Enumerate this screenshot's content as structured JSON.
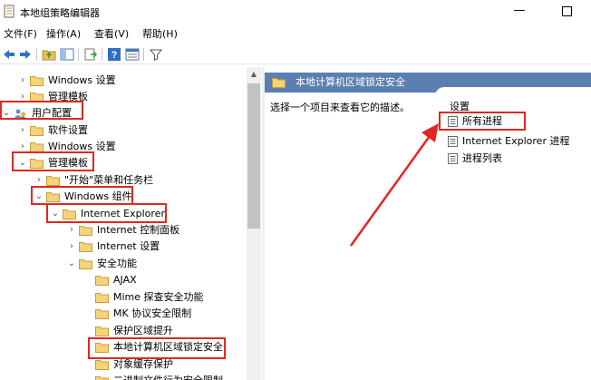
{
  "window": {
    "title": "本地组策略编辑器",
    "minimize_glyph": "—"
  },
  "menu": [
    "文件(F)",
    "操作(A)",
    "查看(V)",
    "帮助(H)"
  ],
  "toolbar_icons": [
    "back-arrow-icon",
    "forward-arrow-icon",
    "up-folder-icon",
    "show-tree-icon",
    "export-list-icon",
    "help-icon",
    "properties-icon",
    "filter-icon"
  ],
  "tree": [
    {
      "label": "Windows 设置",
      "arrow": "›"
    },
    {
      "label": "管理模板",
      "arrow": "›"
    },
    {
      "label": "用户配置",
      "arrow": "⌄"
    },
    {
      "label": "软件设置",
      "arrow": "›"
    },
    {
      "label": "Windows 设置",
      "arrow": "›"
    },
    {
      "label": "管理模板",
      "arrow": "⌄"
    },
    {
      "label": "\"开始\"菜单和任务栏",
      "arrow": "›"
    },
    {
      "label": "Windows 组件",
      "arrow": "⌄"
    },
    {
      "label": "Internet Explorer",
      "arrow": "⌄"
    },
    {
      "label": "Internet 控制面板",
      "arrow": "›"
    },
    {
      "label": "Internet 设置",
      "arrow": "›"
    },
    {
      "label": "安全功能",
      "arrow": "⌄"
    },
    {
      "label": "AJAX",
      "arrow": ""
    },
    {
      "label": "Mime 探查安全功能",
      "arrow": ""
    },
    {
      "label": "MK 协议安全限制",
      "arrow": ""
    },
    {
      "label": "保护区域提升",
      "arrow": ""
    },
    {
      "label": "本地计算机区域锁定安全",
      "arrow": ""
    },
    {
      "label": "对象缓存保护",
      "arrow": ""
    },
    {
      "label": "二进制文件行为安全限制",
      "arrow": ""
    }
  ],
  "right_pane": {
    "header": "本地计算机区域锁定安全",
    "description": "选择一个项目来查看它的描述。",
    "column_header": "设置",
    "policies": [
      "所有进程",
      "Internet Explorer 进程",
      "进程列表"
    ]
  },
  "colors": {
    "highlight_red": "#e32620",
    "header_blue": "#5b7fb1",
    "folder_yellow": "#e8c15a"
  }
}
